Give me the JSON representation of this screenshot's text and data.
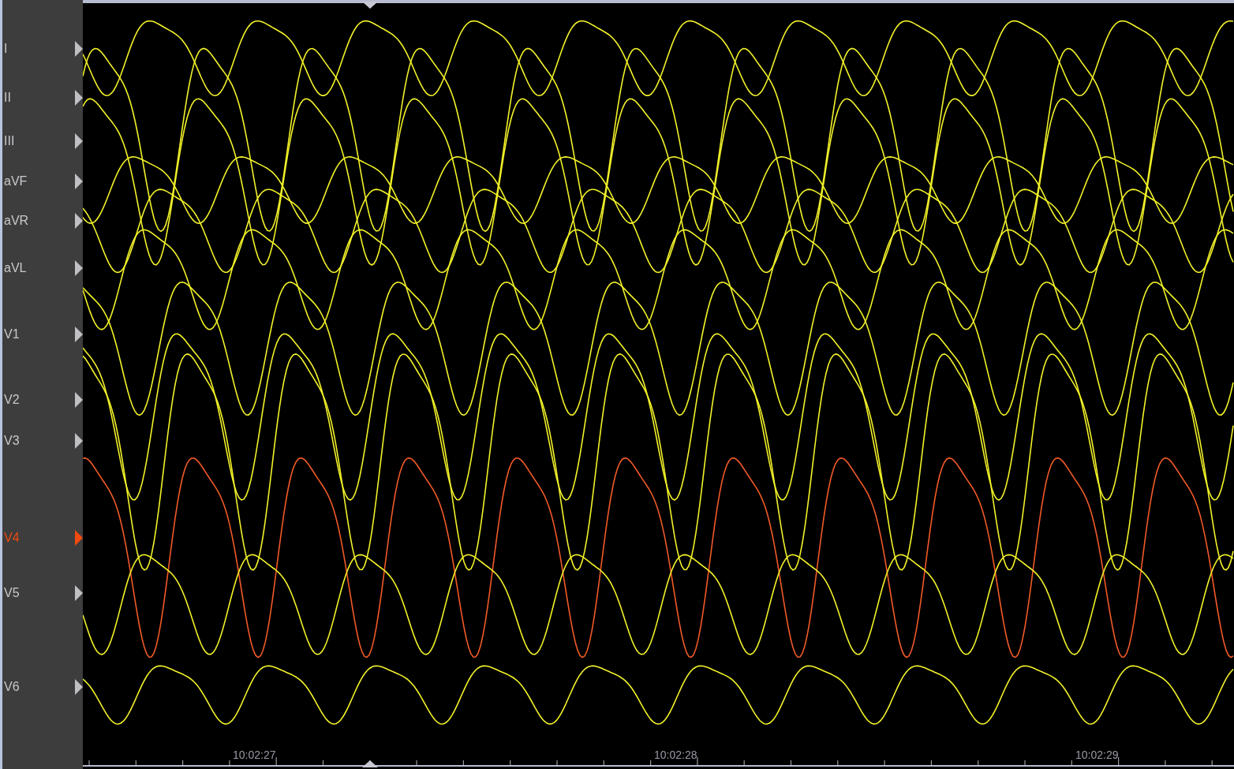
{
  "leads": [
    {
      "label": "I",
      "selected": false
    },
    {
      "label": "II",
      "selected": false
    },
    {
      "label": "III",
      "selected": false
    },
    {
      "label": "aVF",
      "selected": false
    },
    {
      "label": "aVR",
      "selected": false
    },
    {
      "label": "aVL",
      "selected": false
    },
    {
      "label": "V1",
      "selected": false
    },
    {
      "label": "V2",
      "selected": false
    },
    {
      "label": "V3",
      "selected": false
    },
    {
      "label": "V4",
      "selected": true
    },
    {
      "label": "V5",
      "selected": false
    },
    {
      "label": "V6",
      "selected": false
    }
  ],
  "time_axis": {
    "labels": [
      "10:02:27",
      "10:02:28",
      "10:02:29"
    ]
  }
}
